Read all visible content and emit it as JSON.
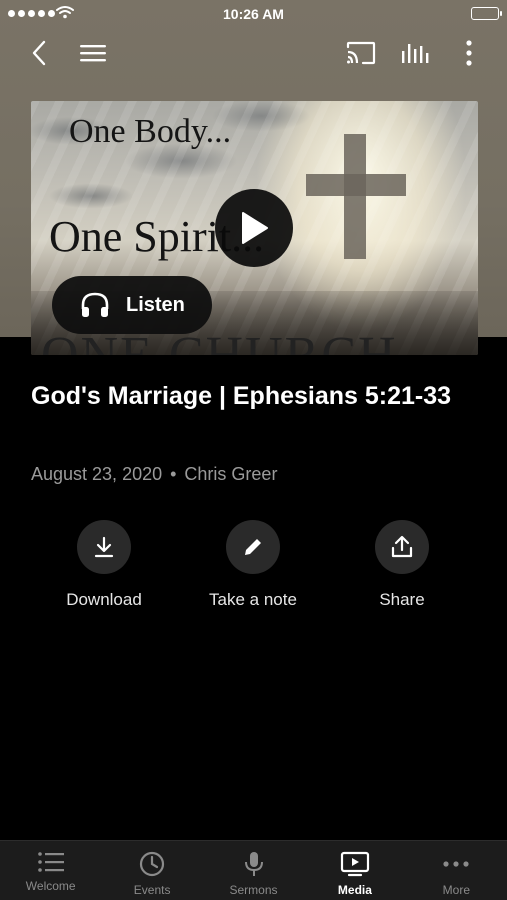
{
  "status_bar": {
    "time": "10:26 AM"
  },
  "nav": {
    "icons": [
      "back-icon",
      "hamburger-menu-icon",
      "cast-icon",
      "audio-bars-icon",
      "more-vertical-icon"
    ]
  },
  "artwork": {
    "line1": "One Body...",
    "line2": "One Spirit...",
    "line3": "ONE CHURCH"
  },
  "player": {
    "listen_label": "Listen"
  },
  "sermon": {
    "title": "God's Marriage | Ephesians 5:21-33",
    "date": "August 23, 2020",
    "separator": "•",
    "speaker": "Chris Greer"
  },
  "actions": [
    {
      "label": "Download",
      "icon": "download-icon"
    },
    {
      "label": "Take a note",
      "icon": "pencil-icon"
    },
    {
      "label": "Share",
      "icon": "share-icon"
    }
  ],
  "tabs": [
    {
      "label": "Welcome",
      "icon": "list-icon",
      "active": false
    },
    {
      "label": "Events",
      "icon": "clock-icon",
      "active": false
    },
    {
      "label": "Sermons",
      "icon": "microphone-icon",
      "active": false
    },
    {
      "label": "Media",
      "icon": "tv-play-icon",
      "active": true
    },
    {
      "label": "More",
      "icon": "more-horizontal-icon",
      "active": false
    }
  ],
  "colors": {
    "background": "#000000",
    "header": "#756f62",
    "muted_text": "#9a9a9a",
    "tab_bar": "#1c1c1c"
  }
}
